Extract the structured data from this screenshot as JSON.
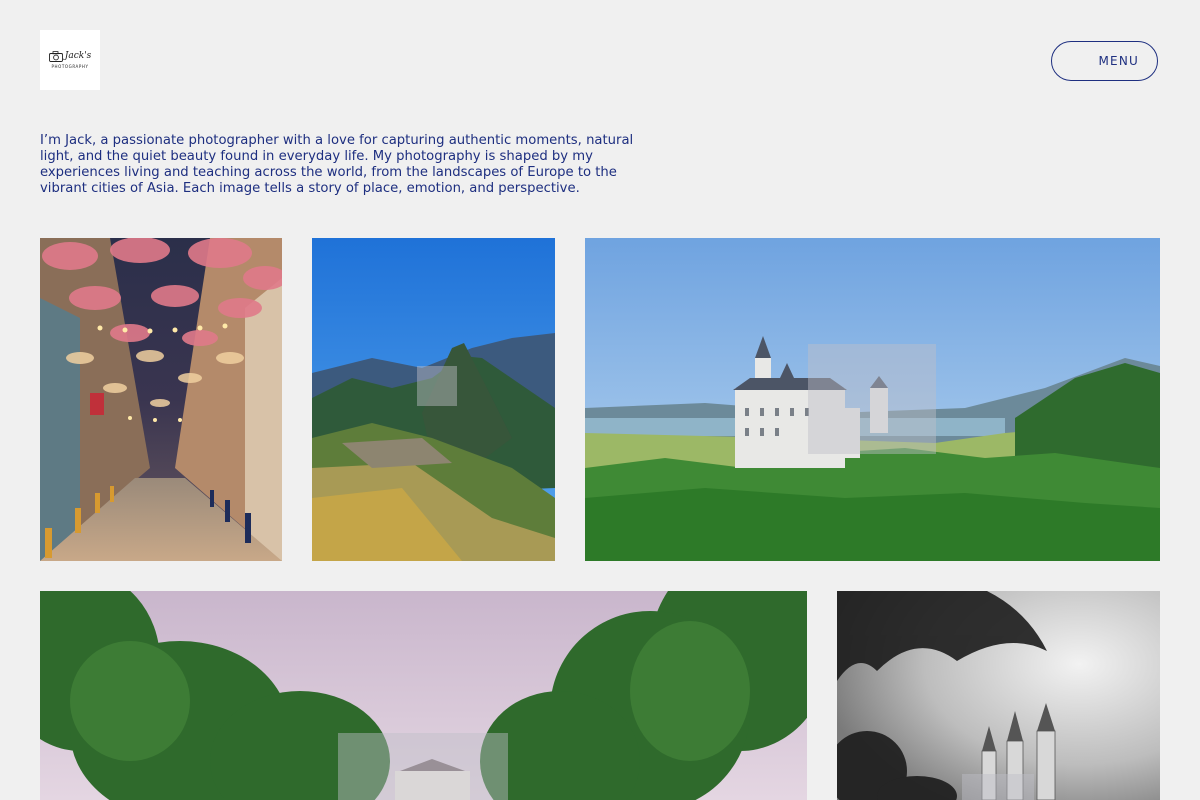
{
  "header": {
    "logo": {
      "script": "Jack's",
      "sub": "PHOTOGRAPHY"
    },
    "menu_label": "MENU"
  },
  "intro": {
    "text": "I’m Jack, a passionate photographer with a love for capturing authentic moments, natural light, and the quiet beauty found in everyday life. My photography is shaped by my experiences living and teaching across the world, from the landscapes of Europe to the vibrant cities of Asia. Each image tells a story of place, emotion, and perspective."
  },
  "gallery": {
    "photos": [
      {
        "name": "umbrella-street-photo",
        "subject": "street with hanging umbrellas at night"
      },
      {
        "name": "machu-picchu-photo",
        "subject": "mountain ruins under blue sky"
      },
      {
        "name": "castle-landscape-photo",
        "subject": "white castle on forested hill with lake"
      },
      {
        "name": "palace-avenue-photo",
        "subject": "tree-lined avenue leading to palace"
      },
      {
        "name": "bw-castle-photo",
        "subject": "black and white castle spires with branches"
      }
    ]
  },
  "colors": {
    "background": "#f0f0f0",
    "text_accent": "#1e2f80"
  }
}
